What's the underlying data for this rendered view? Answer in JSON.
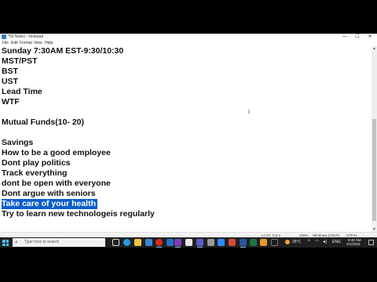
{
  "window": {
    "title": "*50 Notes - Notepad",
    "minimize": "—",
    "maximize": "☐",
    "close": "✕"
  },
  "menu": {
    "file": "File",
    "edit": "Edit",
    "format": "Format",
    "view": "View",
    "help": "Help"
  },
  "editor": {
    "lines": [
      "Sunday 7:30AM EST-9:30/10:30",
      "MST/PST",
      "BST",
      "UST",
      "Lead Time",
      "WTF",
      "",
      "Mutual Funds(10- 20)",
      "",
      "Savings",
      "How to be a good employee",
      "Dont play politics",
      "Track everything",
      "dont be open with everyone",
      "Dont argue with seniors",
      "Take care of your health",
      "Try to learn new technologeis regularly"
    ],
    "selected_line": 15
  },
  "status": {
    "position": "Ln 27, Col 1",
    "zoom": "100%",
    "line_endings": "Windows (CRLF)",
    "encoding": "UTF-8"
  },
  "taskbar": {
    "search_placeholder": "Type here to search",
    "apps": [
      "task-view",
      "edge",
      "file-explorer",
      "store",
      "mail",
      "chrome",
      "vlc",
      "notepad",
      "teams",
      "settings",
      "zoom",
      "photos",
      "word",
      "excel",
      "terminal"
    ],
    "weather": "26°C",
    "time": "9:40 AM",
    "date": "4/1/2023",
    "colors": {
      "taskbar_bg": "#202020",
      "selection": "#0a5fc8",
      "start": "#4cc2ff"
    }
  }
}
